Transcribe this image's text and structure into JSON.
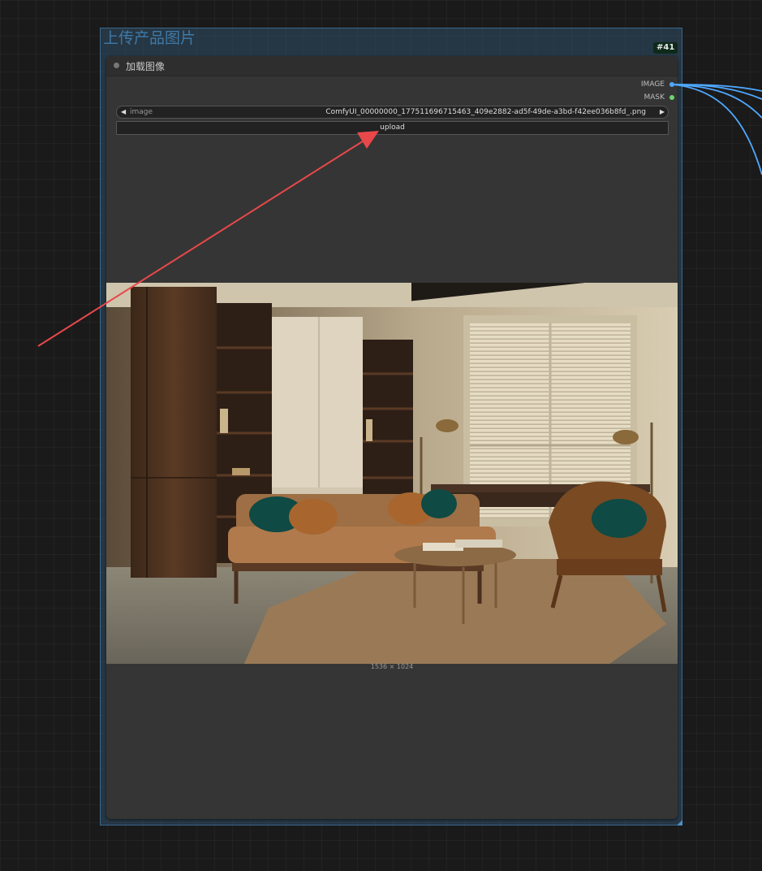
{
  "group": {
    "title": "上传产品图片"
  },
  "node": {
    "id_badge": "#41",
    "title": "加载图像",
    "outputs": [
      {
        "label": "IMAGE",
        "color": "#4fa8ff"
      },
      {
        "label": "MASK",
        "color": "#6fd46f"
      }
    ],
    "image_widget": {
      "label": "image",
      "value": "ComfyUI_00000000_177511696715463_409e2882-ad5f-49de-a3bd-f42ee036b8fd_.png",
      "prev_icon": "◀",
      "next_icon": "▶"
    },
    "upload_label": "upload",
    "preview_dims": "1536 × 1024"
  },
  "colors": {
    "link": "#4fa8ff",
    "annotation_arrow": "#e8484a",
    "group_title": "#3f79a6"
  },
  "icons": [
    "collapse-dot-icon",
    "arrow-left-icon",
    "arrow-right-icon",
    "annotation-arrow-icon"
  ]
}
